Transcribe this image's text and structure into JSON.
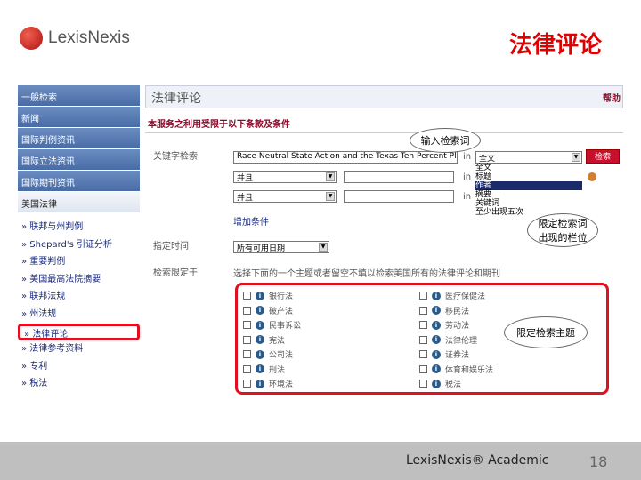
{
  "logo": "LexisNexis",
  "title": "法律评论",
  "sidebar": {
    "nav": [
      "一般检索",
      "新闻",
      "国际判例资讯",
      "国际立法资讯",
      "国际期刊资讯",
      "美国法律"
    ],
    "links": [
      "联邦与州判例",
      "Shepard's 引证分析",
      "重要判例",
      "美国最高法院摘要",
      "联邦法规",
      "州法规",
      "法律评论",
      "法律参考资料",
      "专利",
      "税法"
    ]
  },
  "main": {
    "heading": "法律评论",
    "help": "帮助",
    "terms": "本服务之利用受限于以下条款及条件",
    "keyword_label": "关键字检索",
    "query": "Race Neutral State Action and the Texas Ten Percent Plan",
    "in": "in",
    "connector": "并且",
    "field": "全文",
    "field_options": [
      "全文",
      "标题",
      "作者",
      "摘要",
      "关键词",
      "至少出现五次"
    ],
    "search_button": "检索",
    "add_condition": "增加条件",
    "date_label": "指定时间",
    "date_value": "所有可用日期",
    "limit_label": "检索限定于",
    "limit_text": "选择下面的一个主题或者留空不填以检索美国所有的法律评论和期刊",
    "topics_left": [
      "银行法",
      "破产法",
      "民事诉讼",
      "宪法",
      "公司法",
      "刑法",
      "环境法"
    ],
    "topics_right": [
      "医疗保健法",
      "移民法",
      "劳动法",
      "法律伦理",
      "证券法",
      "体育和娱乐法",
      "税法"
    ]
  },
  "callouts": {
    "query": "输入检索词",
    "field": "限定检索词出现的栏位",
    "topic": "限定检索主题"
  },
  "footer": {
    "brand": "LexisNexis® Academic",
    "page": "18"
  }
}
